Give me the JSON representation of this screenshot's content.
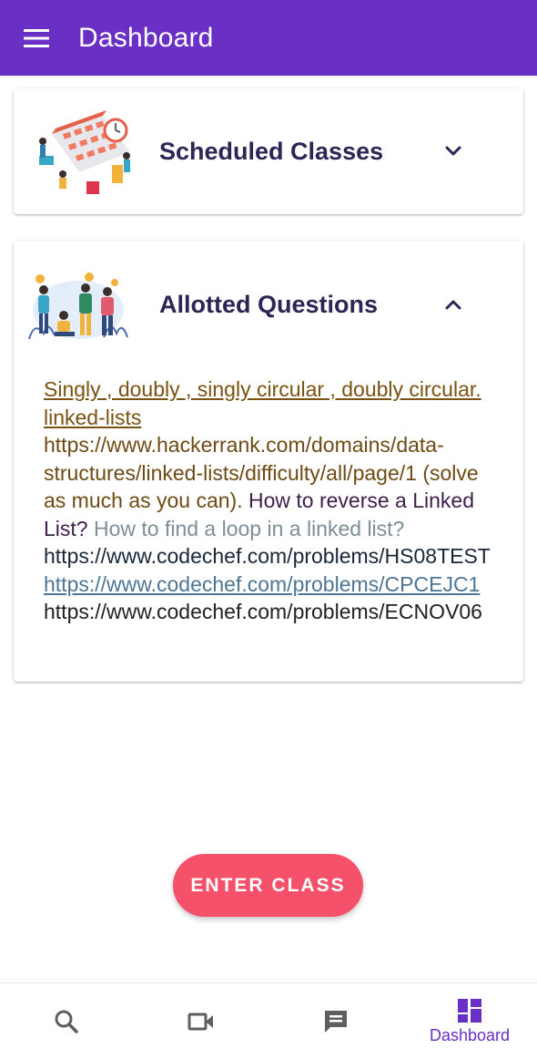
{
  "appbar": {
    "title": "Dashboard",
    "menu_icon": "hamburger-menu-icon",
    "color": "#6a2fc4"
  },
  "cards": [
    {
      "title": "Scheduled Classes",
      "state": "collapsed",
      "chevron_icon": "chevron-down-icon",
      "illustration": "calendar-illustration"
    },
    {
      "title": "Allotted Questions",
      "state": "expanded",
      "chevron_icon": "chevron-up-icon",
      "illustration": "students-illustration",
      "content": {
        "link1": "Singly , doubly , singly circular , doubly circular. linked-lists",
        "hackerrank": "https://www.hackerrank.com/domains/data-structures/linked-lists/difficulty/all/page/1 (solve as much as you can).",
        "reverse": " How to reverse a Linked List?",
        "loop": " How to find a loop in a linked list?",
        "codechef1": "https://www.codechef.com/problems/HS08TEST",
        "codechef2": "https://www.codechef.com/problems/CPCEJC1",
        "codechef3": "https://www.codechef.com/problems/ECNOV06"
      }
    }
  ],
  "enter_button": {
    "label": "ENTER CLASS",
    "color": "#f5516a"
  },
  "bottom_nav": {
    "items": [
      {
        "icon": "search-icon",
        "label": ""
      },
      {
        "icon": "video-camera-icon",
        "label": ""
      },
      {
        "icon": "chat-icon",
        "label": ""
      },
      {
        "icon": "dashboard-icon",
        "label": "Dashboard",
        "active": true
      }
    ],
    "active_color": "#6a2fc4"
  }
}
